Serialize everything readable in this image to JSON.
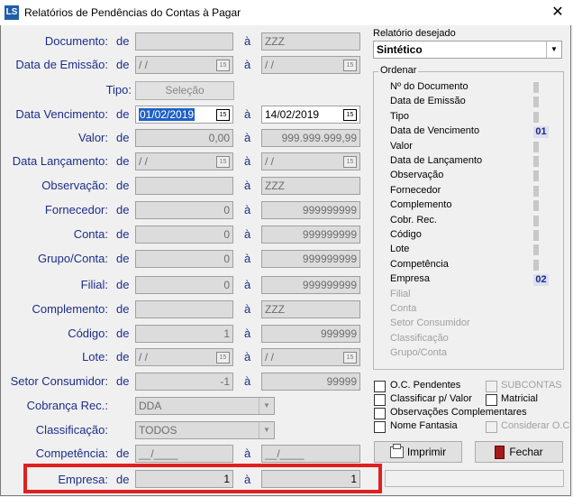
{
  "window": {
    "title": "Relatórios de Pendências do Contas à Pagar",
    "icon_text": "LS",
    "close": "✕"
  },
  "common": {
    "de": "de",
    "a": "à"
  },
  "rows": {
    "documento": {
      "label": "Documento:",
      "from": "",
      "to": "ZZZ"
    },
    "emissao": {
      "label": "Data de Emissão:",
      "from": " / /",
      "to": " / /"
    },
    "tipo": {
      "label": "Tipo:",
      "button": "Seleção"
    },
    "vencimento": {
      "label": "Data Vencimento:",
      "from": "01/02/2019",
      "to": "14/02/2019"
    },
    "valor": {
      "label": "Valor:",
      "from": "0,00",
      "to": "999.999.999,99"
    },
    "lancamento": {
      "label": "Data Lançamento:",
      "from": " / /",
      "to": " / /"
    },
    "observacao": {
      "label": "Observação:",
      "from": "",
      "to": "ZZZ"
    },
    "fornecedor": {
      "label": "Fornecedor:",
      "from": "0",
      "to": "999999999"
    },
    "conta": {
      "label": "Conta:",
      "from": "0",
      "to": "999999999"
    },
    "grupo": {
      "label": "Grupo/Conta:",
      "from": "0",
      "to": "999999999"
    },
    "filial": {
      "label": "Filial:",
      "from": "0",
      "to": "999999999"
    },
    "complemento": {
      "label": "Complemento:",
      "from": "",
      "to": "ZZZ"
    },
    "codigo": {
      "label": "Código:",
      "from": "1",
      "to": "999999"
    },
    "lote": {
      "label": "Lote:",
      "from": " / /",
      "to": " / /"
    },
    "setor": {
      "label": "Setor Consumidor:",
      "from": "-1",
      "to": "99999"
    },
    "cobranca": {
      "label": "Cobrança Rec.:",
      "value": "DDA"
    },
    "classificacao": {
      "label": "Classificação:",
      "value": "TODOS"
    },
    "competencia": {
      "label": "Competência:",
      "from": "__/____",
      "to": "__/____"
    },
    "empresa": {
      "label": "Empresa:",
      "from": "1",
      "to": "1"
    }
  },
  "calendar_icon": "15",
  "relatorio": {
    "label": "Relatório desejado",
    "value": "Sintético"
  },
  "ordenar": {
    "title": "Ordenar",
    "items": [
      {
        "label": "Nº do Documento",
        "order": ""
      },
      {
        "label": "Data de Emissão",
        "order": ""
      },
      {
        "label": "Tipo",
        "order": ""
      },
      {
        "label": "Data de Vencimento",
        "order": "01"
      },
      {
        "label": "Valor",
        "order": ""
      },
      {
        "label": "Data de Lançamento",
        "order": ""
      },
      {
        "label": "Observação",
        "order": ""
      },
      {
        "label": "Fornecedor",
        "order": ""
      },
      {
        "label": "Complemento",
        "order": ""
      },
      {
        "label": "Cobr. Rec.",
        "order": ""
      },
      {
        "label": "Código",
        "order": ""
      },
      {
        "label": "Lote",
        "order": ""
      },
      {
        "label": "Competência",
        "order": ""
      },
      {
        "label": "Empresa",
        "order": "02"
      },
      {
        "label": "Filial",
        "order": ""
      },
      {
        "label": "Conta",
        "order": ""
      },
      {
        "label": "Setor Consumidor",
        "order": ""
      },
      {
        "label": "Classificação",
        "order": ""
      },
      {
        "label": "Grupo/Conta",
        "order": ""
      }
    ]
  },
  "options": {
    "oc_pendentes": "O.C. Pendentes",
    "subcontas": "SUBCONTAS",
    "classificar_valor": "Classificar p/ Valor",
    "matricial": "Matricial",
    "observacoes": "Observações Complementares",
    "nome_fantasia": "Nome Fantasia",
    "considerar_oc": "Considerar O.C."
  },
  "buttons": {
    "imprimir": "Imprimir",
    "fechar": "Fechar"
  }
}
